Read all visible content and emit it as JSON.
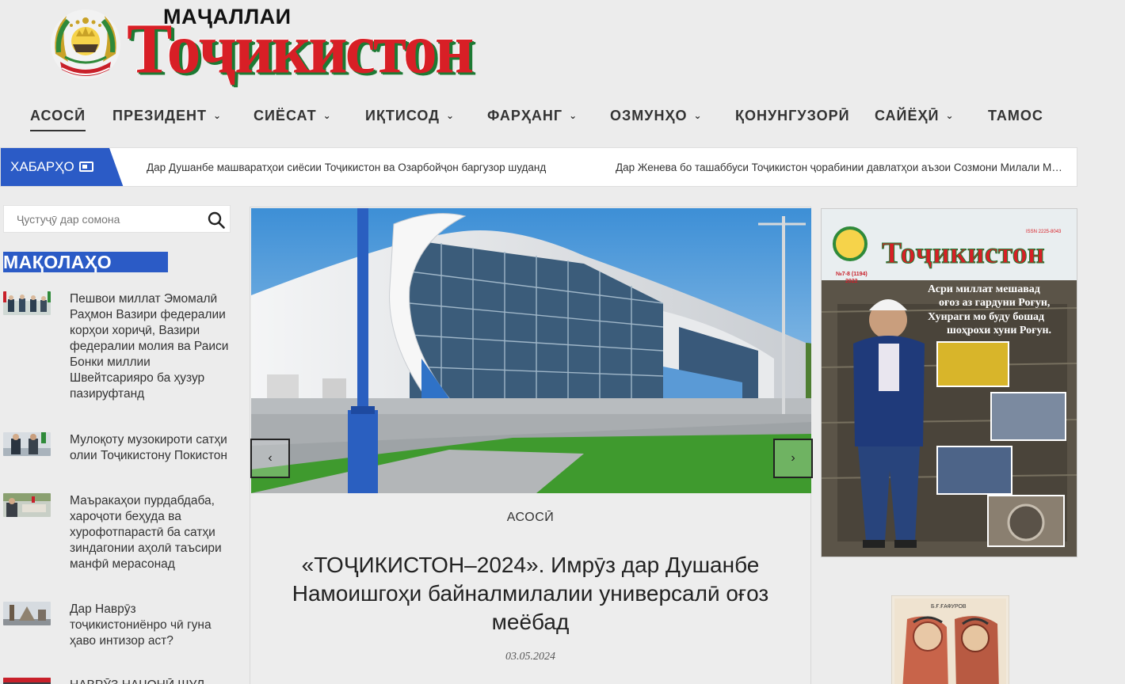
{
  "logo": {
    "small_text": "МАҶАЛЛАИ",
    "big_text": "Тоҷикистон"
  },
  "nav": {
    "items": [
      {
        "label": "АСОСӢ",
        "has_dropdown": false,
        "active": true
      },
      {
        "label": "ПРЕЗИДЕНТ",
        "has_dropdown": true
      },
      {
        "label": "СИЁСАТ",
        "has_dropdown": true
      },
      {
        "label": "ИҚТИСОД",
        "has_dropdown": true
      },
      {
        "label": "ФАРҲАНГ",
        "has_dropdown": true
      },
      {
        "label": "ОЗМУНҲО",
        "has_dropdown": true
      },
      {
        "label": "ҚОНУНГУЗОРӢ",
        "has_dropdown": false
      },
      {
        "label": "САЙЁҲӢ",
        "has_dropdown": true
      },
      {
        "label": "ТАМОС",
        "has_dropdown": false
      }
    ]
  },
  "ticker": {
    "label": "ХАБАРҲО",
    "items": [
      "Дар Душанбе машваратҳои сиёсии Тоҷикистон ва Озарбойҷон баргузор шуданд",
      "Дар Женева бо ташаббуси Тоҷикистон ҷорабинии давлатҳои аъзои Созмони Милали Муттаҳид"
    ]
  },
  "search": {
    "placeholder": "Ҷустуҷӯ дар сомона"
  },
  "sidebar": {
    "section_title": "МАҚОЛАҲО",
    "articles": [
      {
        "title": "Пешвои миллат Эмомалӣ Раҳмон Вазири федералии корҳои хориҷӣ, Вазири федералии молия ва Раиси Бонки миллии Швейтсарияро ба ҳузур пазируфтанд"
      },
      {
        "title": "Мулоқоту музокироти сатҳи олии Тоҷикистону Покистон"
      },
      {
        "title": "Маъракаҳои пурдабдаба, хароҷоти беҳуда ва хурофотпарастӣ ба сатҳи зиндагонии аҳолӣ таъсири манфӣ мерасонад"
      },
      {
        "title": "Дар Наврӯз тоҷикистониёнро чӣ гуна ҳаво интизор аст?"
      },
      {
        "title": "НАВРӮЗ НАҶОНӢ ШУЛ"
      }
    ]
  },
  "slider": {
    "prev": "‹",
    "next": "›",
    "category": "АСОСӢ",
    "title": "«ТОҶИКИСТОН–2024». Имрӯз дар Душанбе Намоишгоҳи байналмилалии универсалӣ оғоз меёбад",
    "date": "03.05.2024"
  },
  "cover": {
    "title": "Тоҷикистон",
    "issn": "ISSN 2225-8043",
    "issue": "№7-8 (1194)",
    "year": "2022",
    "caption_lines": [
      "Асри миллат мешавад",
      "оғоз аз гардуни Роғун,",
      "Хунраги мо буду бошад",
      "шоҳрохи хуни Роғун."
    ]
  },
  "book": {
    "author": "Б.Ғ.ҒАФУРОВ"
  },
  "colors": {
    "accent_blue": "#2b5bc6",
    "logo_red": "#d81f26",
    "logo_green": "#1d7a34"
  }
}
